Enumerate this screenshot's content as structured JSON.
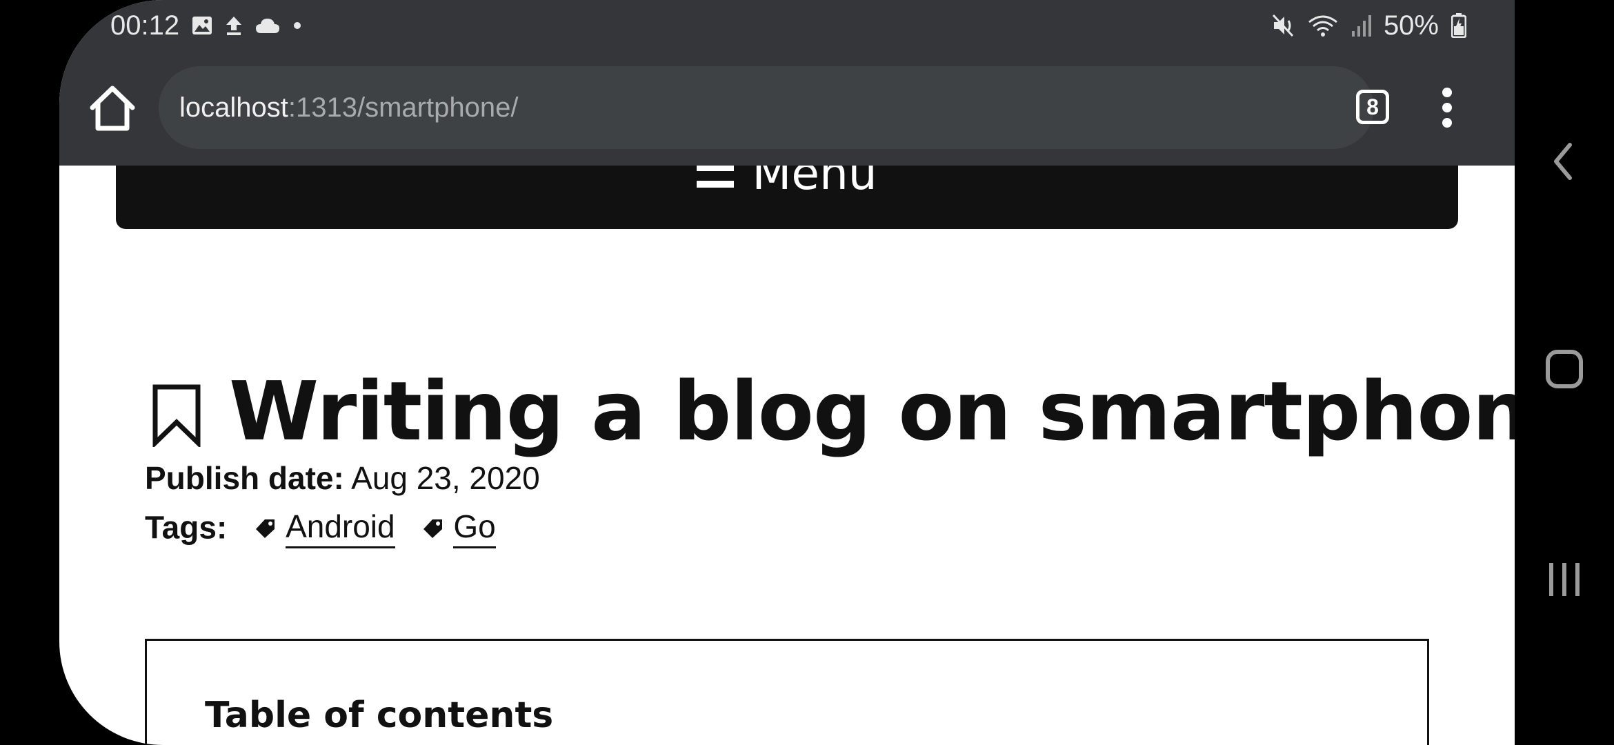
{
  "status_bar": {
    "time": "00:12",
    "battery": "50%",
    "left_icons": [
      "image-icon",
      "upload-icon",
      "cloud-icon",
      "dot-icon"
    ],
    "right_icons": [
      "mute-icon",
      "wifi-icon",
      "signal-icon",
      "battery-icon"
    ]
  },
  "browser": {
    "url_host": "localhost",
    "url_path": ":1313/smartphone/",
    "tab_count": "8"
  },
  "page": {
    "menu_label": "Menu",
    "title": "Writing a blog on smartphone",
    "publish_label": "Publish date:",
    "publish_date": "Aug 23, 2020",
    "tags_label": "Tags:",
    "tags": [
      "Android",
      "Go"
    ],
    "toc_title": "Table of contents"
  },
  "colors": {
    "chrome_bg": "#35363a",
    "urlbar_bg": "#3f4245",
    "menu_bg": "#111111",
    "text": "#111111"
  }
}
